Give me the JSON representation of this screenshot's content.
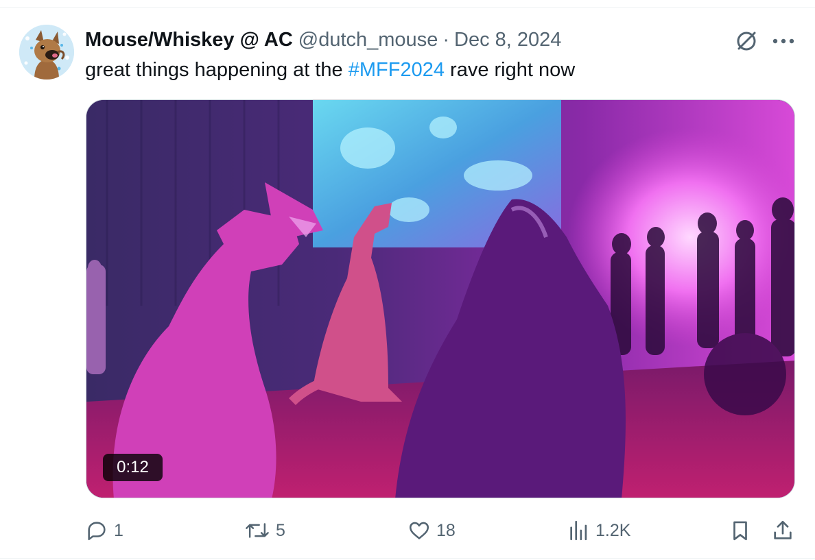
{
  "tweet": {
    "display_name": "Mouse/Whiskey @ AC",
    "handle": "@dutch_mouse",
    "separator": "·",
    "date": "Dec 8, 2024",
    "text_before": "great things happening at the ",
    "hashtag": "#MFF2024",
    "text_after": " rave right now"
  },
  "media": {
    "duration": "0:12"
  },
  "actions": {
    "replies": "1",
    "retweets": "5",
    "likes": "18",
    "views": "1.2K"
  },
  "colors": {
    "accent": "#1d9bf0",
    "secondary_text": "#536471",
    "primary_text": "#0f1419"
  },
  "icons": [
    "grok-icon",
    "more-icon",
    "reply-icon",
    "retweet-icon",
    "like-icon",
    "views-icon",
    "bookmark-icon",
    "share-icon",
    "play-duration"
  ]
}
